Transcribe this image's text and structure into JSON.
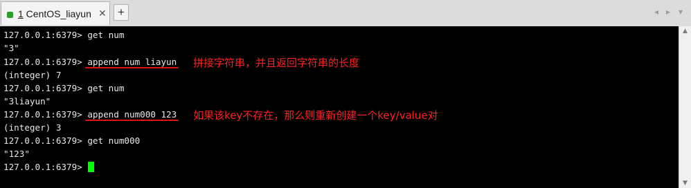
{
  "tabbar": {
    "tab": {
      "number": "1",
      "title": " CentOS_liayun",
      "close": "✕"
    },
    "add_tab": "+",
    "nav_left": "◂",
    "nav_right": "▸",
    "nav_menu": "▾"
  },
  "terminal": {
    "prompt": "127.0.0.1:6379> ",
    "lines": [
      {
        "prompt": "127.0.0.1:6379> ",
        "cmd": "get num"
      },
      {
        "text": "\"3\""
      },
      {
        "prompt": "127.0.0.1:6379> ",
        "cmd": "append num liayun"
      },
      {
        "text": "(integer) 7"
      },
      {
        "prompt": "127.0.0.1:6379> ",
        "cmd": "get num"
      },
      {
        "text": "\"3liayun\""
      },
      {
        "prompt": "127.0.0.1:6379> ",
        "cmd": "append num000 123"
      },
      {
        "text": "(integer) 3"
      },
      {
        "prompt": "127.0.0.1:6379> ",
        "cmd": "get num000"
      },
      {
        "text": "\"123\""
      },
      {
        "prompt": "127.0.0.1:6379> "
      }
    ]
  },
  "annotations": {
    "append_existing": "拼接字符串，并且返回字符串的长度",
    "append_new": "如果该key不存在，那么则重新创建一个key/value对"
  },
  "colors": {
    "cursor": "#00ff00",
    "annotation": "#ff2020",
    "tab_dot": "#2e9e2e"
  }
}
